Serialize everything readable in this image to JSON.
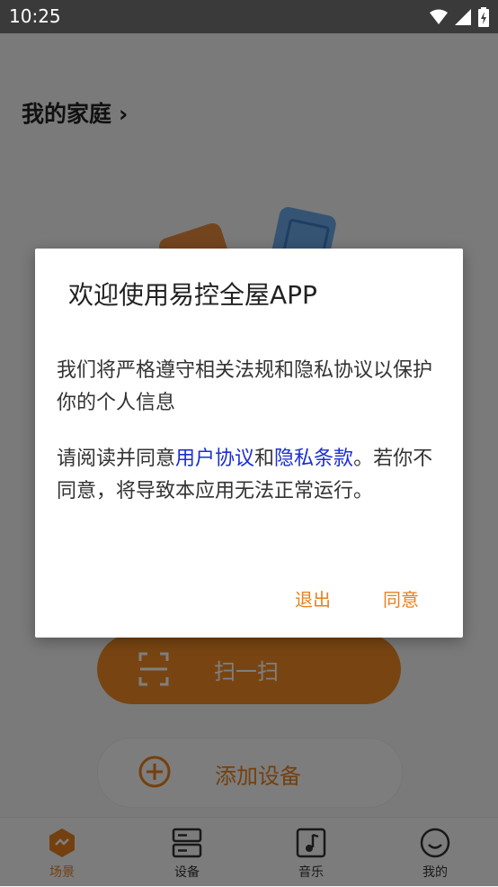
{
  "status_bar": {
    "time": "10:25"
  },
  "home": {
    "title": "我的家庭",
    "chevron": "›"
  },
  "actions": {
    "scan_label": "扫一扫",
    "add_label": "添加设备"
  },
  "tabs": [
    {
      "label": "场景",
      "icon": "scene-icon",
      "active": true
    },
    {
      "label": "设备",
      "icon": "device-icon",
      "active": false
    },
    {
      "label": "音乐",
      "icon": "music-icon",
      "active": false
    },
    {
      "label": "我的",
      "icon": "smiley-icon",
      "active": false
    }
  ],
  "dialog": {
    "title": "欢迎使用易控全屋APP",
    "p1": "我们将严格遵守相关法规和隐私协议以保护你的个人信息",
    "p2_prefix": "请阅读并同意",
    "link_user": "用户协议",
    "and": "和",
    "link_privacy": "隐私条款",
    "p2_suffix": "。若你不同意，将导致本应用无法正常运行。",
    "exit_label": "退出",
    "agree_label": "同意"
  },
  "colors": {
    "accent": "#f08a24",
    "link": "#1a2fd0",
    "status_bar": "#3a3a3a",
    "overlay": "rgba(0,0,0,0.5)"
  }
}
